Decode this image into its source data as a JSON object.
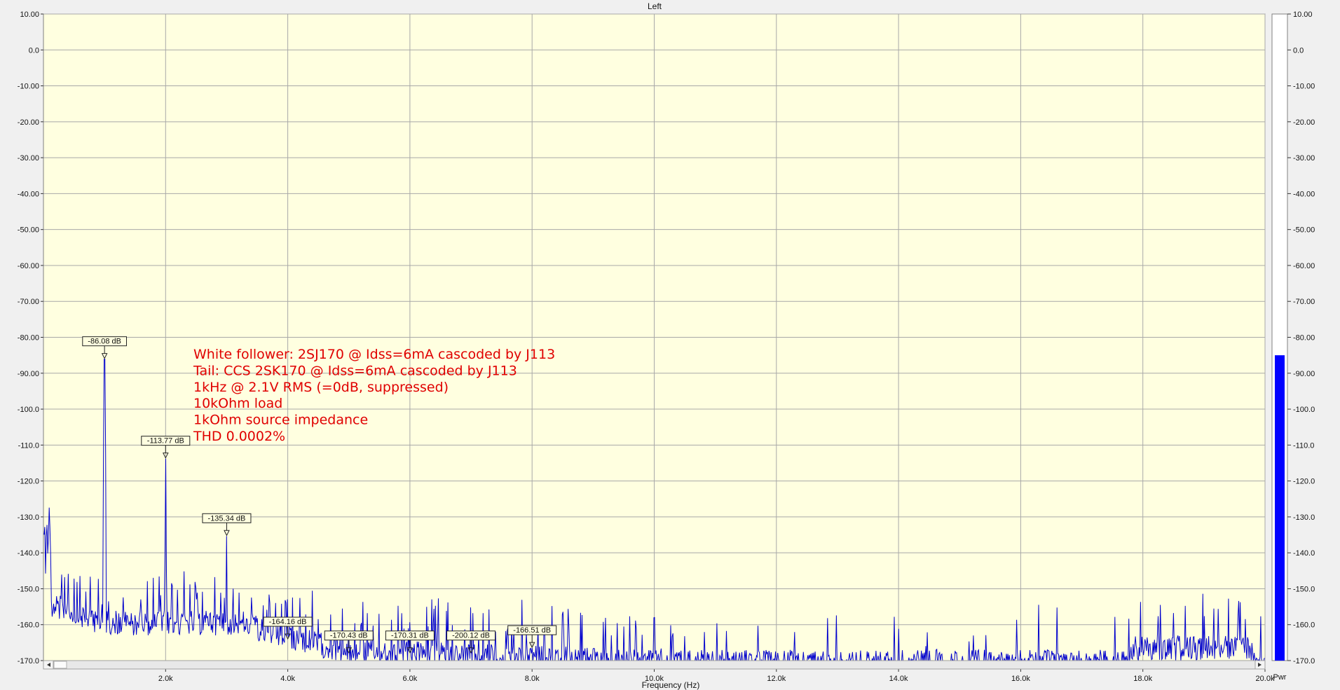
{
  "chart_data": {
    "type": "line",
    "title": "Left",
    "xlabel": "Frequency (Hz)",
    "ylabel": "",
    "xlim": [
      0,
      20000
    ],
    "ylim": [
      -170,
      10
    ],
    "x_ticks": [
      2000,
      4000,
      6000,
      8000,
      10000,
      12000,
      14000,
      16000,
      18000,
      20000
    ],
    "x_tick_labels": [
      "2.0k",
      "4.0k",
      "6.0k",
      "8.0k",
      "10.0k",
      "12.0k",
      "14.0k",
      "16.0k",
      "18.0k",
      "20.0k"
    ],
    "y_ticks": [
      10,
      0,
      -10,
      -20,
      -30,
      -40,
      -50,
      -60,
      -70,
      -80,
      -90,
      -100,
      -110,
      -120,
      -130,
      -140,
      -150,
      -160,
      -170
    ],
    "y_tick_labels": [
      "10.00",
      "0.0",
      "-10.00",
      "-20.00",
      "-30.00",
      "-40.00",
      "-50.00",
      "-60.00",
      "-70.00",
      "-80.00",
      "-90.00",
      "-100.0",
      "-110.0",
      "-120.0",
      "-130.0",
      "-140.0",
      "-150.0",
      "-160.0",
      "-170.0"
    ],
    "grid": true,
    "series_color": "#0000cc",
    "plot_background": "#ffffe0",
    "harmonic_markers": [
      {
        "freq": 1000,
        "level": -86.08,
        "label": "-86.08 dB"
      },
      {
        "freq": 2000,
        "level": -113.77,
        "label": "-113.77 dB"
      },
      {
        "freq": 3000,
        "level": -135.34,
        "label": "-135.34 dB"
      },
      {
        "freq": 4000,
        "level": -164.16,
        "label": "-164.16 dB"
      },
      {
        "freq": 5000,
        "level": -170.43,
        "label": "-170.43 dB"
      },
      {
        "freq": 6000,
        "level": -170.31,
        "label": "-170.31 dB"
      },
      {
        "freq": 7000,
        "level": -200.12,
        "label": "-200.12 dB"
      },
      {
        "freq": 8000,
        "level": -166.51,
        "label": "-166.51 dB"
      }
    ],
    "annotations": [
      "White follower: 2SJ170 @ Idss=6mA cascoded by J113",
      "Tail: CCS 2SK170 @ Idss=6mA cascoded by J113",
      "1kHz @ 2.1V RMS (=0dB, suppressed)",
      "10kOhm load",
      "1kOhm source impedance",
      "THD 0.0002%"
    ],
    "meter": {
      "label": "Pwr",
      "level": -85,
      "color": "#0000ff",
      "y_tick_labels": [
        "10.00",
        "0.0",
        "-10.00",
        "-20.00",
        "-30.00",
        "-40.00",
        "-50.00",
        "-60.00",
        "-70.00",
        "-80.00",
        "-90.00",
        "-100.0",
        "-110.0",
        "-120.0",
        "-130.0",
        "-140.0",
        "-150.0",
        "-160.0",
        "-170.0"
      ]
    }
  }
}
